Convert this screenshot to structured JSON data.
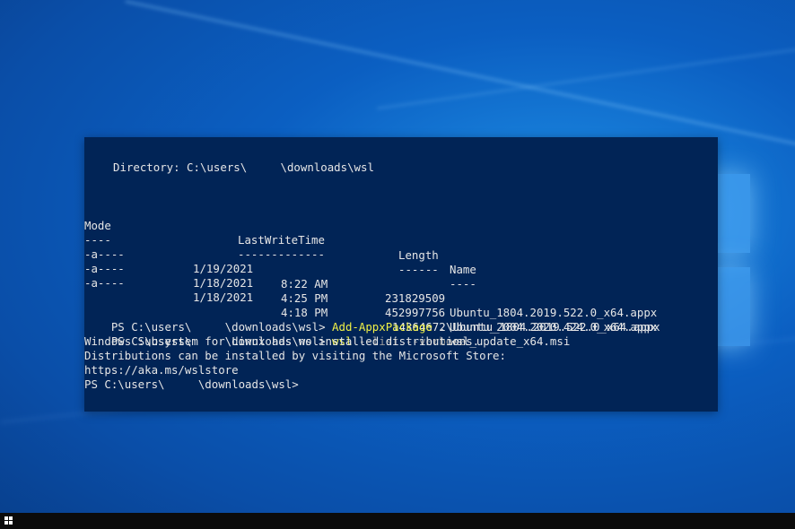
{
  "terminal": {
    "directory_line": "Directory: C:\\users\\     \\downloads\\wsl",
    "headers": {
      "mode": "Mode",
      "lastwrite": "LastWriteTime",
      "length": "Length",
      "name": "Name"
    },
    "underlines": {
      "mode": "----",
      "lastwrite": "-------------",
      "length": "------",
      "name": "----"
    },
    "files": [
      {
        "mode": "-a----",
        "date": "1/19/2021",
        "time": "8:22 AM",
        "length": "231829509",
        "name": "Ubuntu_1804.2019.522.0_x64.appx"
      },
      {
        "mode": "-a----",
        "date": "1/18/2021",
        "time": "4:25 PM",
        "length": "452997756",
        "name": "Ubuntu_2004.2020.424.0_x64.appx"
      },
      {
        "mode": "-a----",
        "date": "1/18/2021",
        "time": "4:18 PM",
        "length": "14364672",
        "name": "wsl_update_x64.msi"
      }
    ],
    "command1": {
      "prompt": "PS C:\\users\\     \\downloads\\wsl> ",
      "command": "Add-AppxPackage",
      "argument": " .\\Ubuntu_1804.2019.522.0_x64.appx"
    },
    "command2": {
      "prompt": "PS C:\\users\\     \\downloads\\wsl> ",
      "command": "wsl",
      "argument": " --list --verbose"
    },
    "output": [
      "Windows Subsystem for Linux has no installed distributions.",
      "Distributions can be installed by visiting the Microsoft Store:",
      "https://aka.ms/wslstore"
    ],
    "final_prompt": "PS C:\\users\\     \\downloads\\wsl>"
  },
  "colors": {
    "terminal_bg": "#012456",
    "command": "#f2f246",
    "flag": "#9a9a9a",
    "text": "#e6e6e6"
  },
  "taskbar": {
    "start_icon": "windows-start-icon"
  }
}
